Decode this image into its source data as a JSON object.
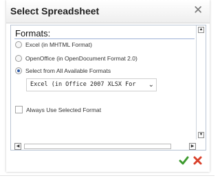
{
  "dialog": {
    "title": "Select Spreadsheet",
    "close_symbol": "✕"
  },
  "formats": {
    "heading": "Formats:",
    "options": [
      {
        "label": "Excel (in MHTML Format)",
        "checked": false
      },
      {
        "label": "OpenOffice (in OpenDocument Format 2.0)",
        "checked": false
      },
      {
        "label": "Select from All Available Formats",
        "checked": true
      }
    ],
    "select_value": "Excel (in Office 2007 XLSX For",
    "always_use_label": "Always Use Selected Format",
    "always_use_checked": false
  },
  "icons": {
    "ok": "check-icon",
    "cancel": "x-icon"
  },
  "colors": {
    "ok_green": "#3c9a2e",
    "cancel_red": "#d9412b",
    "radio_selected": "#2d5aa7"
  }
}
